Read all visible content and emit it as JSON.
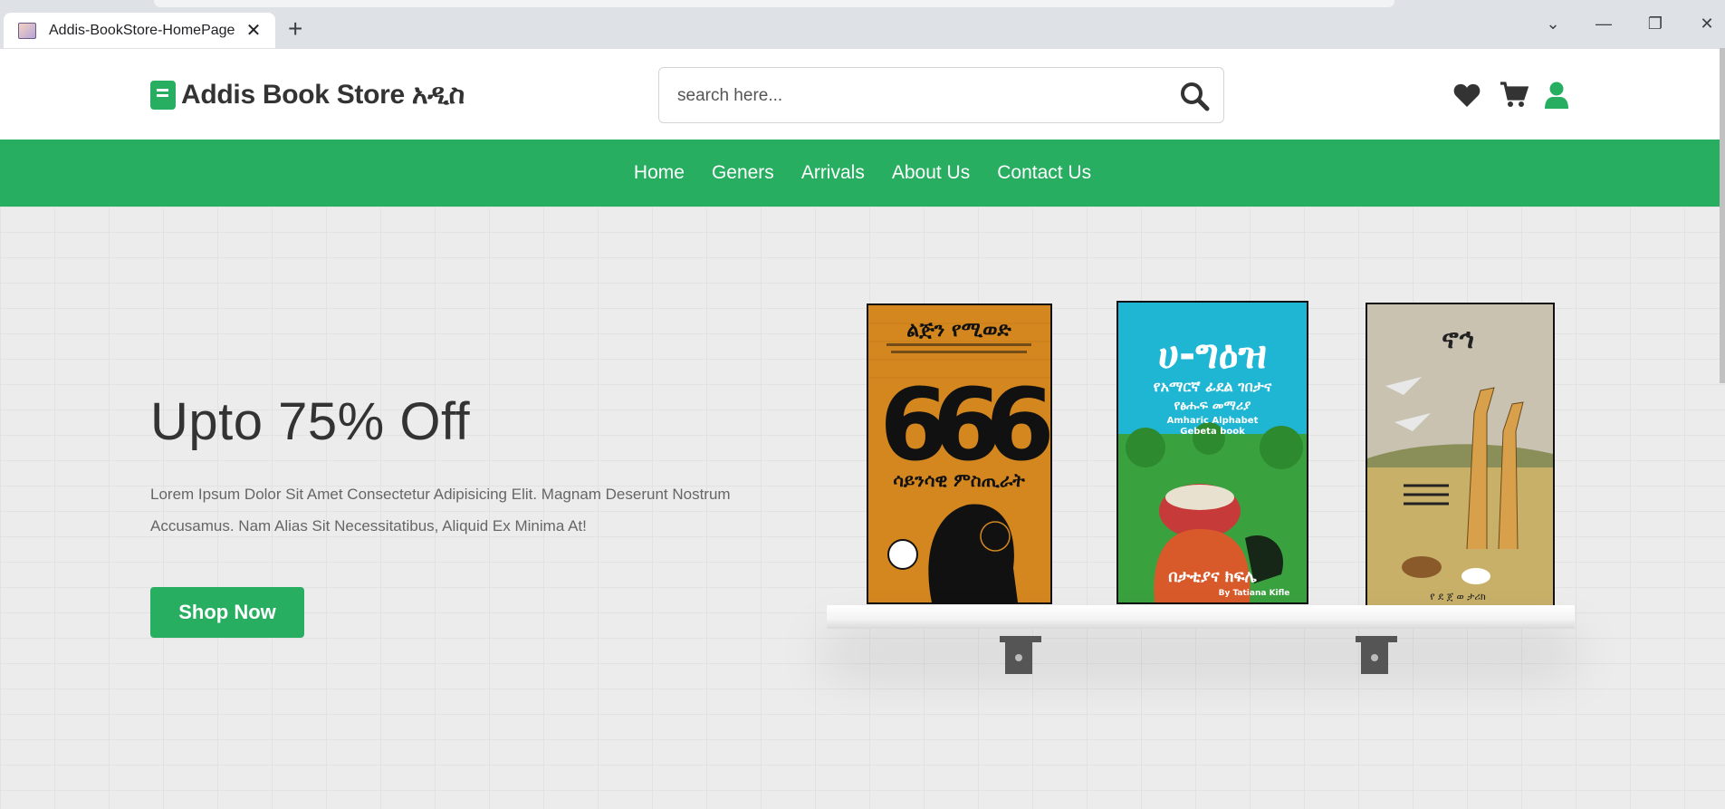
{
  "browser": {
    "tab_title": "Addis-BookStore-HomePage",
    "close_glyph": "✕",
    "new_tab_glyph": "+",
    "window_controls": {
      "dropdown": "⌄",
      "minimize": "—",
      "restore": "❐",
      "close": "✕"
    }
  },
  "header": {
    "logo_icon": "book-icon",
    "logo_text": "Addis Book Store አዲስ",
    "search_placeholder": "search here...",
    "icons": [
      "heart-icon",
      "cart-icon",
      "user-icon"
    ]
  },
  "navbar": {
    "links": [
      "Home",
      "Geners",
      "Arrivals",
      "About Us",
      "Contact Us"
    ]
  },
  "hero": {
    "title": "Upto 75% Off",
    "text": "Lorem Ipsum Dolor Sit Amet Consectetur Adipisicing Elit. Magnam Deserunt Nostrum Accusamus. Nam Alias Sit Necessitatibus, Aliquid Ex Minima At!",
    "button_label": "Shop Now",
    "books": [
      {
        "title": "ልጅን የሚወድ",
        "number": "666",
        "subtitle": "ሳይንሳዊ ምስጢራት"
      },
      {
        "title": "ሀ-ግዕዝ",
        "subtitle": "የአማርኛ ፊደል ገበታና",
        "subtitle2": "የፅሑፍ መማሪያ",
        "english": "Amharic Alphabet",
        "english2": "Gebeta book",
        "bottom": "በታቲያና ክፍሌ",
        "author": "By Tatiana Kifle"
      },
      {
        "title": "ኖኅ",
        "bottom": "የ ደ ጀ ወ ታሪክ"
      }
    ]
  },
  "colors": {
    "brand": "#27ae60",
    "text_dark": "#333333",
    "text_muted": "#666666"
  }
}
